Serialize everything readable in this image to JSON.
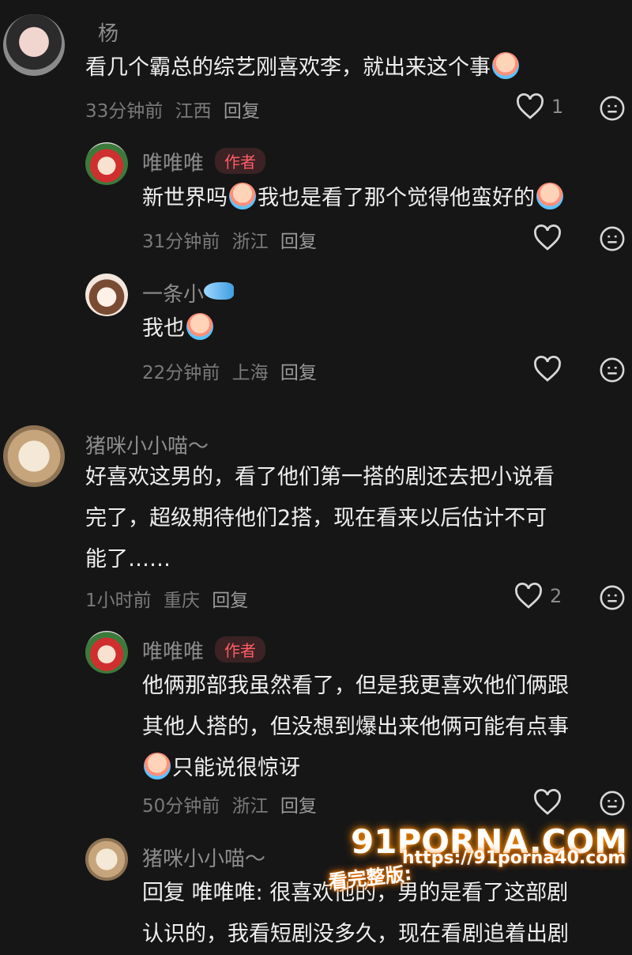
{
  "comments": [
    {
      "name": "杨",
      "text": [
        "看几个霸总的综艺刚喜欢李，就出来这个事"
      ],
      "time": "33分钟前",
      "location": "江西",
      "reply_label": "回复",
      "likes": "1"
    },
    {
      "name": "唯唯唯",
      "tag": "作者",
      "text": [
        "新世界吗",
        "我也是看了那个觉得他蛮好的"
      ],
      "time": "31分钟前",
      "location": "浙江",
      "reply_label": "回复"
    },
    {
      "name": "一条小",
      "text": [
        "我也"
      ],
      "time": "22分钟前",
      "location": "上海",
      "reply_label": "回复"
    },
    {
      "name": "猪咪小小喵～",
      "text": [
        "好喜欢这男的，看了他们第一搭的剧还去把小说看",
        "完了，超级期待他们2搭，现在看来以后估计不可",
        "能了……"
      ],
      "time": "1小时前",
      "location": "重庆",
      "reply_label": "回复",
      "likes": "2"
    },
    {
      "name": "唯唯唯",
      "tag": "作者",
      "text": [
        "他俩那部我虽然看了，但是我更喜欢他们俩跟",
        "其他人搭的，但没想到爆出来他俩可能有点事",
        "只能说很惊讶"
      ],
      "time": "50分钟前",
      "location": "浙江",
      "reply_label": "回复"
    },
    {
      "name": "猪咪小小喵～",
      "text": [
        "回复 唯唯唯: 很喜欢他的，男的是看了这部剧",
        "认识的，我看短剧没多久，现在看剧追着出剧"
      ]
    }
  ],
  "watermark": {
    "brand": "91PORNA.COM",
    "url": "https://91porna40.com",
    "cta": "看完整版:"
  },
  "icons": {
    "like": "heart-outline-icon",
    "dislike": "neutral-face-icon"
  },
  "colors": {
    "background": "#161616",
    "tag_bg": "#3b2224",
    "tag_text": "#ff5d66"
  }
}
